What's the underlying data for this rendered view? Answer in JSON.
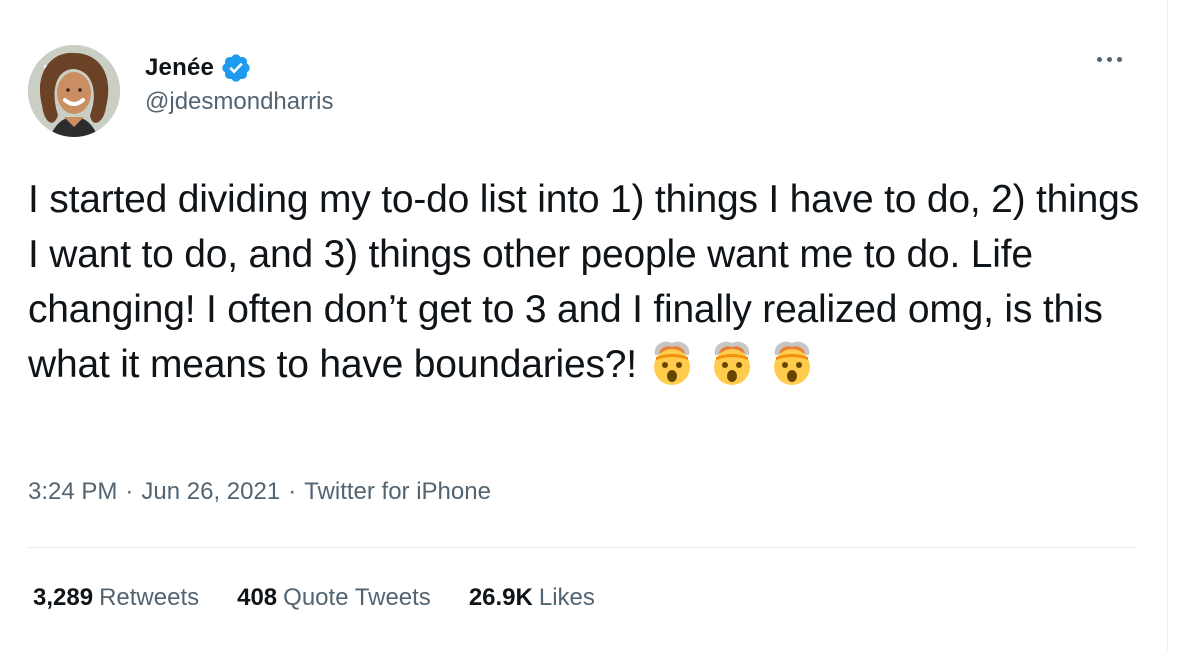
{
  "author": {
    "display_name": "Jenée",
    "handle": "@jdesmondharris",
    "verified": true,
    "avatar_icon": "profile-avatar-cartoon-woman"
  },
  "tweet": {
    "text": "I started dividing my to-do list into 1) things I have to do, 2) things I want to do, and 3) things other people want me to do. Life changing! I often don’t get to 3 and I finally realized omg, is this what it means to have boundaries?!",
    "emojis": [
      "exploding-head-emoji",
      "exploding-head-emoji",
      "exploding-head-emoji"
    ]
  },
  "meta": {
    "time": "3:24 PM",
    "separator": "·",
    "date": "Jun 26, 2021",
    "source": "Twitter for iPhone"
  },
  "stats": {
    "retweets": {
      "value": "3,289",
      "label": "Retweets"
    },
    "quote_tweets": {
      "value": "408",
      "label": "Quote Tweets"
    },
    "likes": {
      "value": "26.9K",
      "label": "Likes"
    }
  },
  "colors": {
    "text": "#0f1419",
    "secondary": "#536471",
    "verified": "#1d9bf0",
    "divider": "#e6ecf0"
  },
  "icons": {
    "more": "more-options-icon",
    "verified": "verified-badge-icon"
  }
}
